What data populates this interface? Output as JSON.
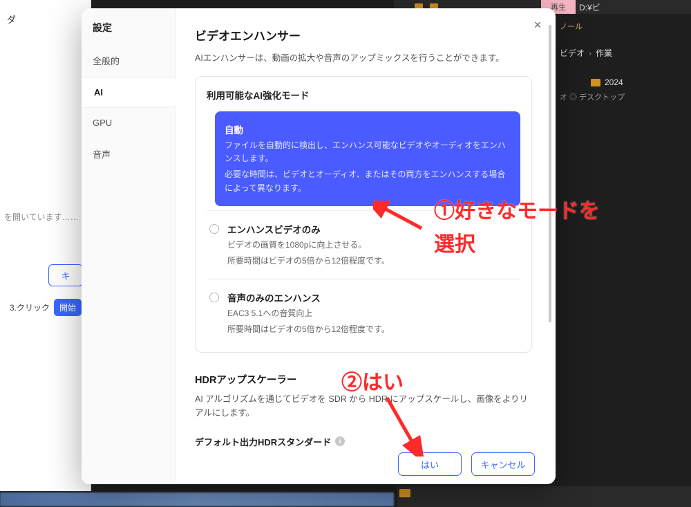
{
  "left": {
    "folder_label": "ダ",
    "opening": "を開いています……",
    "button1": "キ",
    "click_label": "3.クリック",
    "open_btn": "開始"
  },
  "dark": {
    "play": "再生",
    "drive": "D:¥ビ",
    "sub": "ノール",
    "bc1": "ビデオ",
    "bc2": "作業",
    "folder": "2024",
    "desktop": "オ  ◎ デスクトップ"
  },
  "dialog": {
    "title": "設定",
    "nav": {
      "general": "全般的",
      "ai": "AI",
      "gpu": "GPU",
      "audio": "音声"
    },
    "close": "×",
    "enhancer": {
      "title": "ビデオエンハンサー",
      "desc": "AIエンハンサーは、動画の拡大や音声のアップミックスを行うことができます。"
    },
    "modes": {
      "head": "利用可能なAI強化モード",
      "auto": {
        "label": "自動",
        "desc1": "ファイルを自動的に検出し、エンハンス可能なビデオやオーディオをエンハンスします。",
        "desc2": "必要な時間は、ビデオとオーディオ、またはその両方をエンハンスする場合によって異なります。"
      },
      "video": {
        "label": "エンハンスビデオのみ",
        "desc1": "ビデオの画質を1080pに向上させる。",
        "desc2": "所要時間はビデオの5倍から12倍程度です。"
      },
      "audio": {
        "label": "音声のみのエンハンス",
        "desc1": "EAC3 5.1への音質向上",
        "desc2": "所要時間はビデオの5倍から12倍程度です。"
      }
    },
    "hdr": {
      "title": "HDRアップスケーラー",
      "desc": "AI アルゴリズムを通じてビデオを SDR から HDR にアップスケールし、画像をよりリアルにします。",
      "std": "デフォルト出力HDRスタンダード"
    },
    "buttons": {
      "ok": "はい",
      "cancel": "キャンセル"
    }
  },
  "annotations": {
    "a1": "①好きなモードを",
    "a1b": "選択",
    "a2": "②はい"
  }
}
